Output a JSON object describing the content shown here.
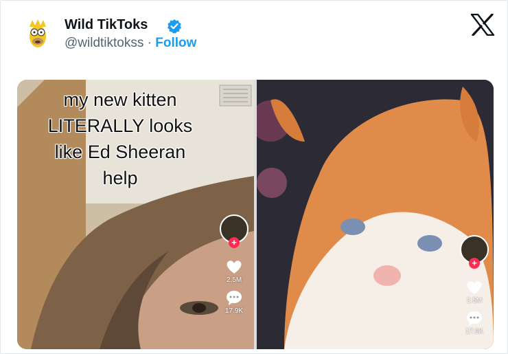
{
  "header": {
    "account_name": "Wild TikToks",
    "handle": "@wildtiktokss",
    "separator": " · ",
    "follow_label": "Follow"
  },
  "media": {
    "left": {
      "caption_lines": [
        "my new kitten",
        "LITERALLY looks",
        "like Ed Sheeran",
        "help"
      ],
      "likes": "2.5M",
      "comments": "17.9K"
    },
    "right": {
      "likes": "2.5M",
      "comments": "17.9K"
    }
  },
  "colors": {
    "accent": "#1d9bf0",
    "tiktok_red": "#fe2c55",
    "text": "#0f1419",
    "muted": "#536471"
  }
}
